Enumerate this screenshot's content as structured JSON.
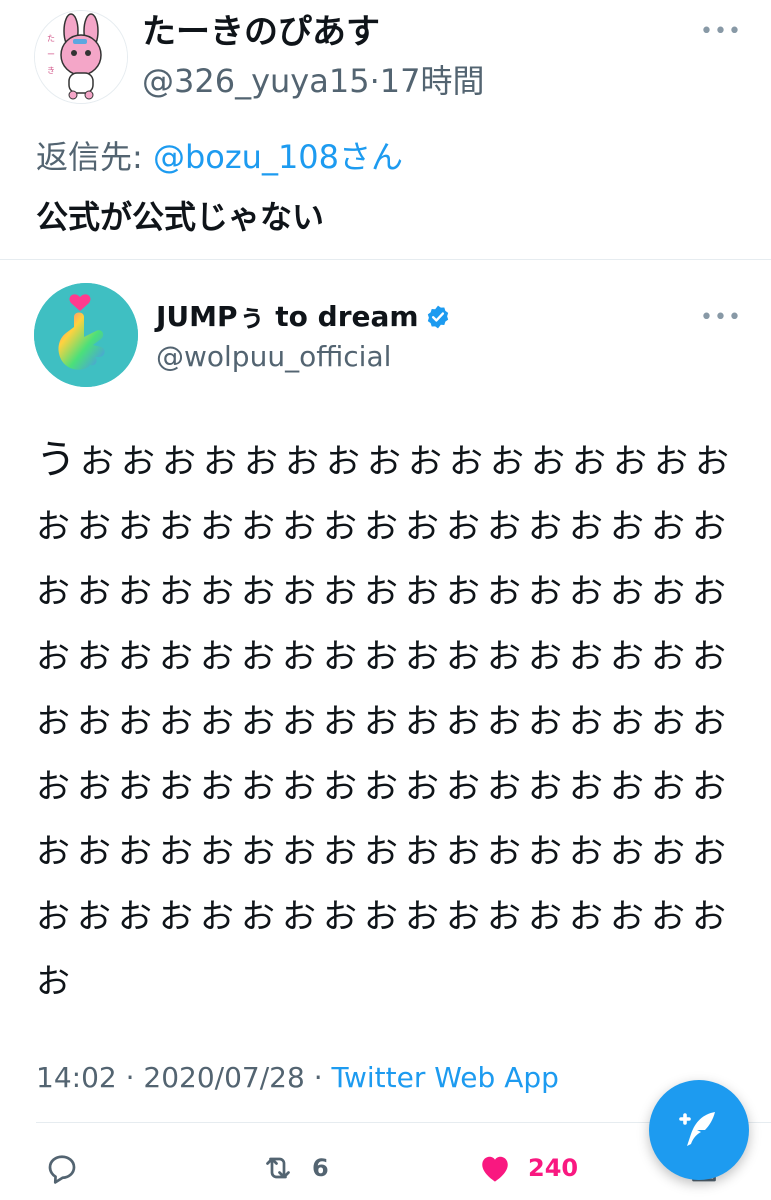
{
  "reply": {
    "display_name": "たーきのぴあす",
    "handle": "@326_yuya15",
    "separator": "·",
    "time": "17時間",
    "reply_prefix": "返信先: ",
    "reply_mention": "@bozu_108さん",
    "text": "公式が公式じゃない"
  },
  "quoted": {
    "display_name": "JUMPぅ to dream",
    "handle": "@wolpuu_official",
    "body_first": "う",
    "body_rest": "おおおおおおおおおおおおおおおおおおおおおおおおおおおおおおおおおおおおおおおおおおおおおおおおおおおおおおおおおおおおおおおおおおおおおおおおおおおおおおおおおおおおおおおおおおおおおおおおおおおおおおおおおおおおおおおおおおおおおおおおおおおおおおおおおおおおおおおお",
    "time": "14:02",
    "date": "2020/07/28",
    "via": "Twitter Web App",
    "sep": " · "
  },
  "actions": {
    "retweet_count": "6",
    "like_count": "240"
  },
  "more_glyph": "•••",
  "colors": {
    "accent": "#1d9bf0",
    "like": "#f91880",
    "muted": "#536471"
  },
  "icons": [
    "more-icon",
    "verified-badge-icon",
    "reply-icon",
    "retweet-icon",
    "like-icon",
    "share-icon",
    "compose-tweet-icon"
  ]
}
